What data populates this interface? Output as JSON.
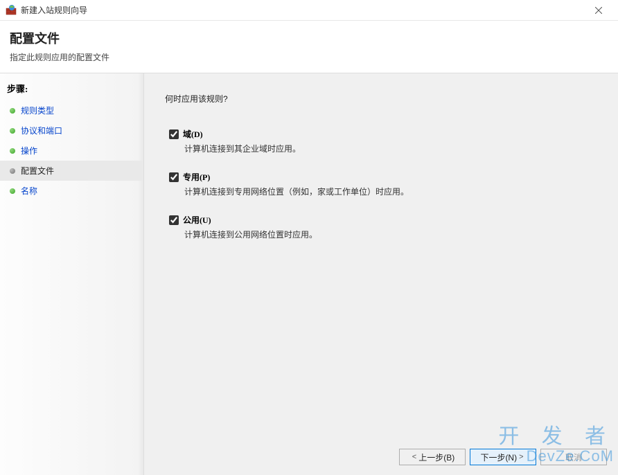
{
  "window": {
    "title": "新建入站规则向导",
    "close_icon": "close"
  },
  "header": {
    "title": "配置文件",
    "subtitle": "指定此规则应用的配置文件"
  },
  "sidebar": {
    "steps_label": "步骤:",
    "items": [
      {
        "label": "规则类型",
        "current": false
      },
      {
        "label": "协议和端口",
        "current": false
      },
      {
        "label": "操作",
        "current": false
      },
      {
        "label": "配置文件",
        "current": true
      },
      {
        "label": "名称",
        "current": false
      }
    ]
  },
  "content": {
    "prompt": "何时应用该规则?",
    "options": [
      {
        "label": "域(D)",
        "checked": true,
        "desc": "计算机连接到其企业域时应用。"
      },
      {
        "label": "专用(P)",
        "checked": true,
        "desc": "计算机连接到专用网络位置（例如，家或工作单位）时应用。"
      },
      {
        "label": "公用(U)",
        "checked": true,
        "desc": "计算机连接到公用网络位置时应用。"
      }
    ]
  },
  "buttons": {
    "back": "上一步(B)",
    "next": "下一步(N)",
    "cancel": "取消"
  },
  "watermark": {
    "line1": "开 发 者",
    "line2": "DevZe.CoM"
  }
}
